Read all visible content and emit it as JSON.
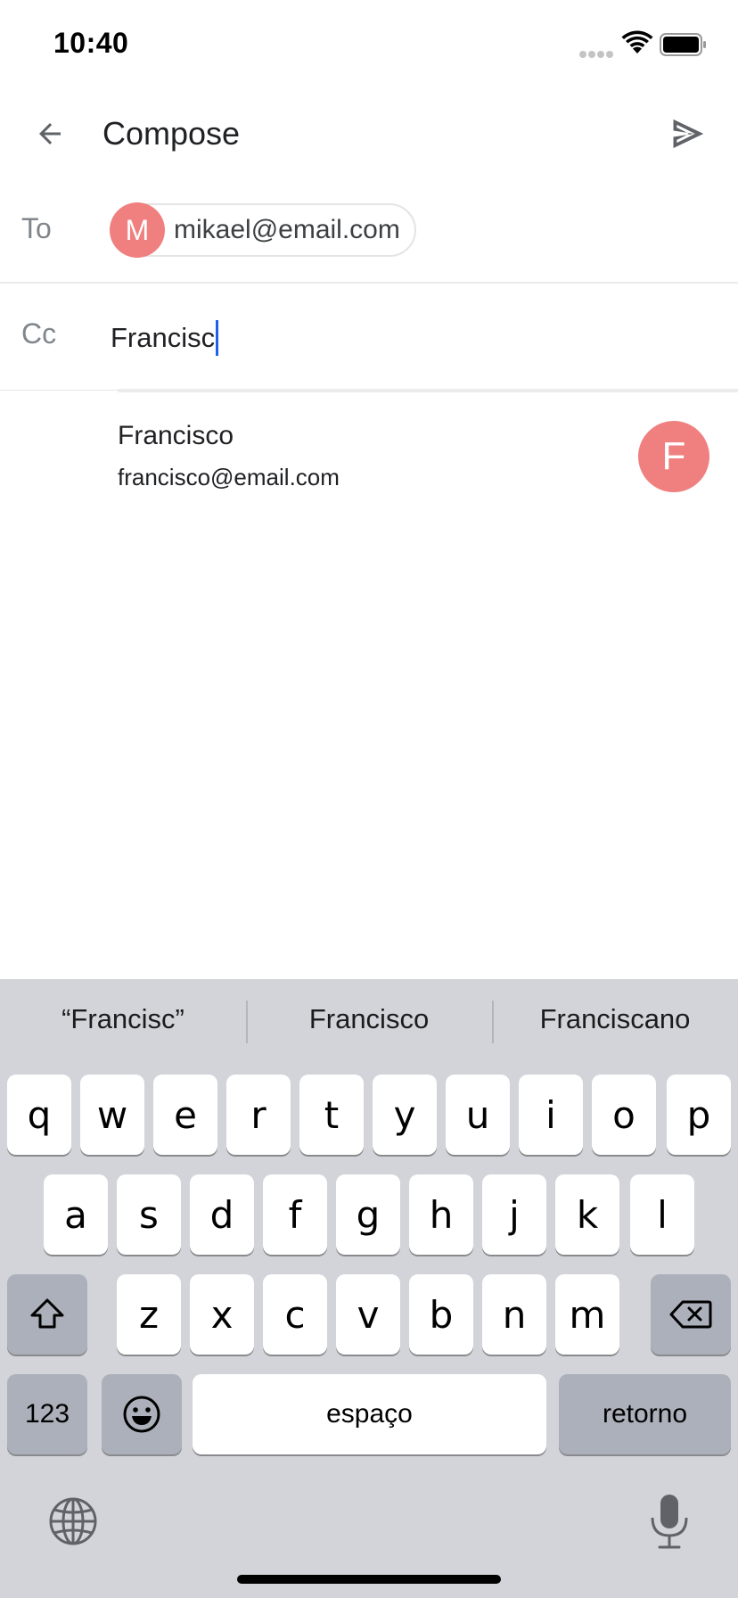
{
  "status_bar": {
    "time": "10:40",
    "icons": [
      "signal-dots-icon",
      "wifi-icon",
      "battery-icon"
    ]
  },
  "header": {
    "back_icon": "arrow-left-icon",
    "title": "Compose",
    "send_icon": "send-icon"
  },
  "to_field": {
    "label": "To",
    "chip": {
      "initial": "M",
      "email": "mikael@email.com"
    }
  },
  "cc_field": {
    "label": "Cc",
    "value": "Francisc"
  },
  "suggestion": {
    "name": "Francisco",
    "email": "francisco@email.com",
    "initial": "F"
  },
  "keyboard": {
    "predictions": [
      "“Francisc”",
      "Francisco",
      "Franciscano"
    ],
    "row1": [
      "q",
      "w",
      "e",
      "r",
      "t",
      "y",
      "u",
      "i",
      "o",
      "p"
    ],
    "row2": [
      "a",
      "s",
      "d",
      "f",
      "g",
      "h",
      "j",
      "k",
      "l"
    ],
    "row3": [
      "z",
      "x",
      "c",
      "v",
      "b",
      "n",
      "m"
    ],
    "numbers_key": "123",
    "space_key": "espaço",
    "return_key": "retorno",
    "shift_icon": "shift-icon",
    "delete_icon": "backspace-icon",
    "emoji_icon": "emoji-icon",
    "globe_icon": "globe-icon",
    "mic_icon": "microphone-icon"
  },
  "colors": {
    "avatar": "#f08080",
    "caret": "#1a62e8",
    "keyboard_bg": "#d2d4d9",
    "dark_key": "#abb0ba"
  }
}
